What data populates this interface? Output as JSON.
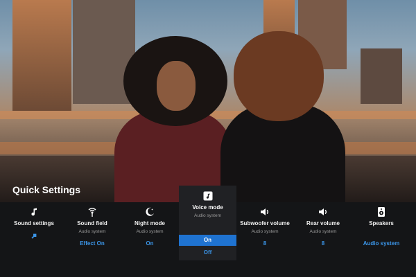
{
  "quick_settings": {
    "title": "Quick Settings",
    "tiles": [
      {
        "title": "Sound settings",
        "subtitle": "",
        "value": "",
        "icon": "music-note-icon"
      },
      {
        "title": "Sound field",
        "subtitle": "Audio system",
        "value": "Effect On",
        "icon": "sound-field-icon"
      },
      {
        "title": "Night mode",
        "subtitle": "Audio system",
        "value": "On",
        "icon": "moon-icon"
      },
      {
        "title": "Subwoofer volume",
        "subtitle": "Audio system",
        "value": "8",
        "icon": "speaker-volume-icon"
      },
      {
        "title": "Rear volume",
        "subtitle": "Audio system",
        "value": "8",
        "icon": "speaker-volume-icon"
      },
      {
        "title": "Speakers",
        "subtitle": "",
        "value": "Audio system",
        "icon": "speaker-icon"
      }
    ],
    "popup": {
      "title": "Voice mode",
      "subtitle": "Audio system",
      "icon": "voice-mode-icon",
      "options": [
        "On",
        "Off"
      ],
      "selected": "On"
    }
  },
  "colors": {
    "accent": "#3b95e8",
    "selected_bg": "#1f73d1",
    "bar_bg": "#141517",
    "popup_bg": "#202124"
  }
}
